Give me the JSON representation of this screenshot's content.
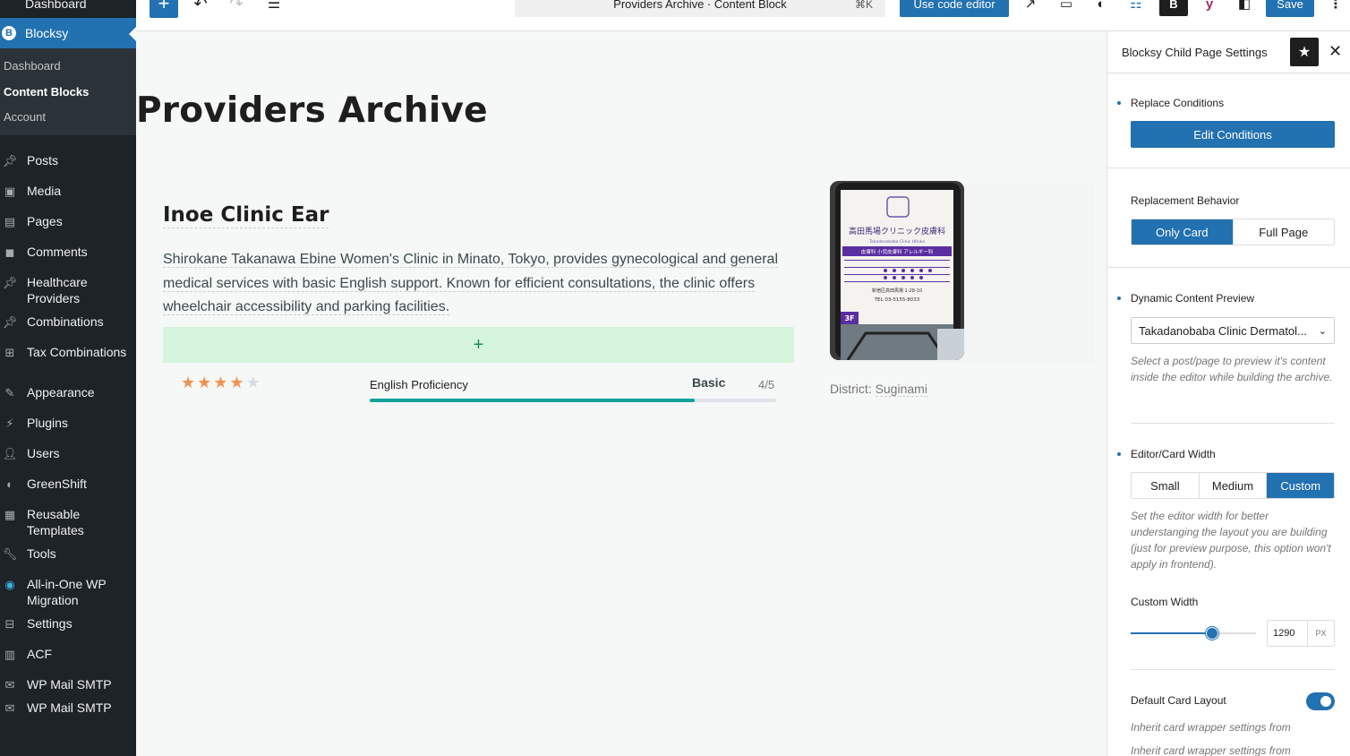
{
  "admin_menu": {
    "top_partial": "Dashboard",
    "active": {
      "label": "Blocksy",
      "icon": "blocksy-icon"
    },
    "submenu": [
      "Dashboard",
      "Content Blocks",
      "Account"
    ],
    "items": [
      {
        "label": "Posts",
        "icon": "pin-icon"
      },
      {
        "label": "Media",
        "icon": "media-icon"
      },
      {
        "label": "Pages",
        "icon": "pages-icon"
      },
      {
        "label": "Comments",
        "icon": "comments-icon"
      },
      {
        "label": "Healthcare Providers",
        "icon": "pin-icon"
      },
      {
        "label": "Combinations",
        "icon": "pin-icon"
      },
      {
        "label": "Tax Combinations",
        "icon": "sitemap-icon"
      },
      {
        "label": "Appearance",
        "icon": "brush-icon"
      },
      {
        "label": "Plugins",
        "icon": "plugin-icon"
      },
      {
        "label": "Users",
        "icon": "users-icon"
      },
      {
        "label": "GreenShift",
        "icon": "greenshift-icon"
      },
      {
        "label": "Reusable Templates",
        "icon": "grid-icon"
      },
      {
        "label": "Tools",
        "icon": "wrench-icon"
      },
      {
        "label": "All-in-One WP Migration",
        "icon": "migration-icon"
      },
      {
        "label": "Settings",
        "icon": "settings-icon"
      },
      {
        "label": "ACF",
        "icon": "acf-icon"
      },
      {
        "label": "WP Mail SMTP",
        "icon": "mail-icon"
      },
      {
        "label": "WP Mail SMTP",
        "icon": "mail-icon"
      }
    ]
  },
  "toolbar": {
    "add": "+",
    "undo": "↶",
    "redo": "↷",
    "outline": "☰",
    "document_title": "Providers Archive · Content Block",
    "shortcut": "⌘K",
    "code_editor_label": "Use code editor",
    "save_label": "Save",
    "blocksy": "B",
    "yoast": "y",
    "more": "⋮"
  },
  "canvas": {
    "page_title": "Providers Archive",
    "card": {
      "title": "Inoe Clinic Ear",
      "description": "Shirokane Takanawa Ebine Women's Clinic in Minato, Tokyo, provides gynecological and general medical services with basic English support. Known for efficient consultations, the clinic offers wheelchair accessibility and parking facilities.",
      "add_block": "+",
      "rating": 4,
      "rating_max": 5,
      "proficiency_label": "English Proficiency",
      "proficiency_level": "Basic",
      "proficiency_score": "4/5",
      "proficiency_fill": 0.8,
      "district_prefix": "District: ",
      "district_value": "Suginami",
      "photo_sign_text": "高田馬場クリニック皮膚科",
      "photo_sign_sub": "Takadanobaba Clinic Hifuka",
      "photo_sign_row": "皮膚科  小児皮膚科  アレルギー科",
      "photo_sign_addr": "新宿区高田馬場 1-28-10",
      "photo_sign_tel": "TEL 03-5155-8033",
      "photo_sign_floor": "3F"
    }
  },
  "panel": {
    "title": "Blocksy Child Page Settings",
    "star": "★",
    "close": "✕",
    "replace_conditions_label": "Replace Conditions",
    "edit_conditions_label": "Edit Conditions",
    "replacement_behavior_label": "Replacement Behavior",
    "replacement_options": [
      "Only Card",
      "Full Page"
    ],
    "dynamic_preview_label": "Dynamic Content Preview",
    "dynamic_preview_value": "Takadanobaba Clinic Dermatol...",
    "dynamic_preview_help": "Select a post/page to preview it's content inside the editor while building the archive.",
    "width_label": "Editor/Card Width",
    "width_options": [
      "Small",
      "Medium",
      "Custom"
    ],
    "width_help": "Set the editor width for better understanging the layout you are building (just for preview purpose, this option won't apply in frontend).",
    "custom_width_label": "Custom Width",
    "custom_width_value": "1290",
    "custom_width_unit": "PX",
    "custom_width_fraction": 0.65,
    "default_card_layout_label": "Default Card Layout",
    "default_card_layout_help": "Inherit card wrapper settings from",
    "default_card_layout_help_2": "Inherit card wrapper settings from"
  },
  "colors": {
    "accent": "#2271b1",
    "sidebar": "#1d2327",
    "star": "#f0934e",
    "progress": "#12a29a",
    "add_block_bg": "#d6f5df"
  }
}
